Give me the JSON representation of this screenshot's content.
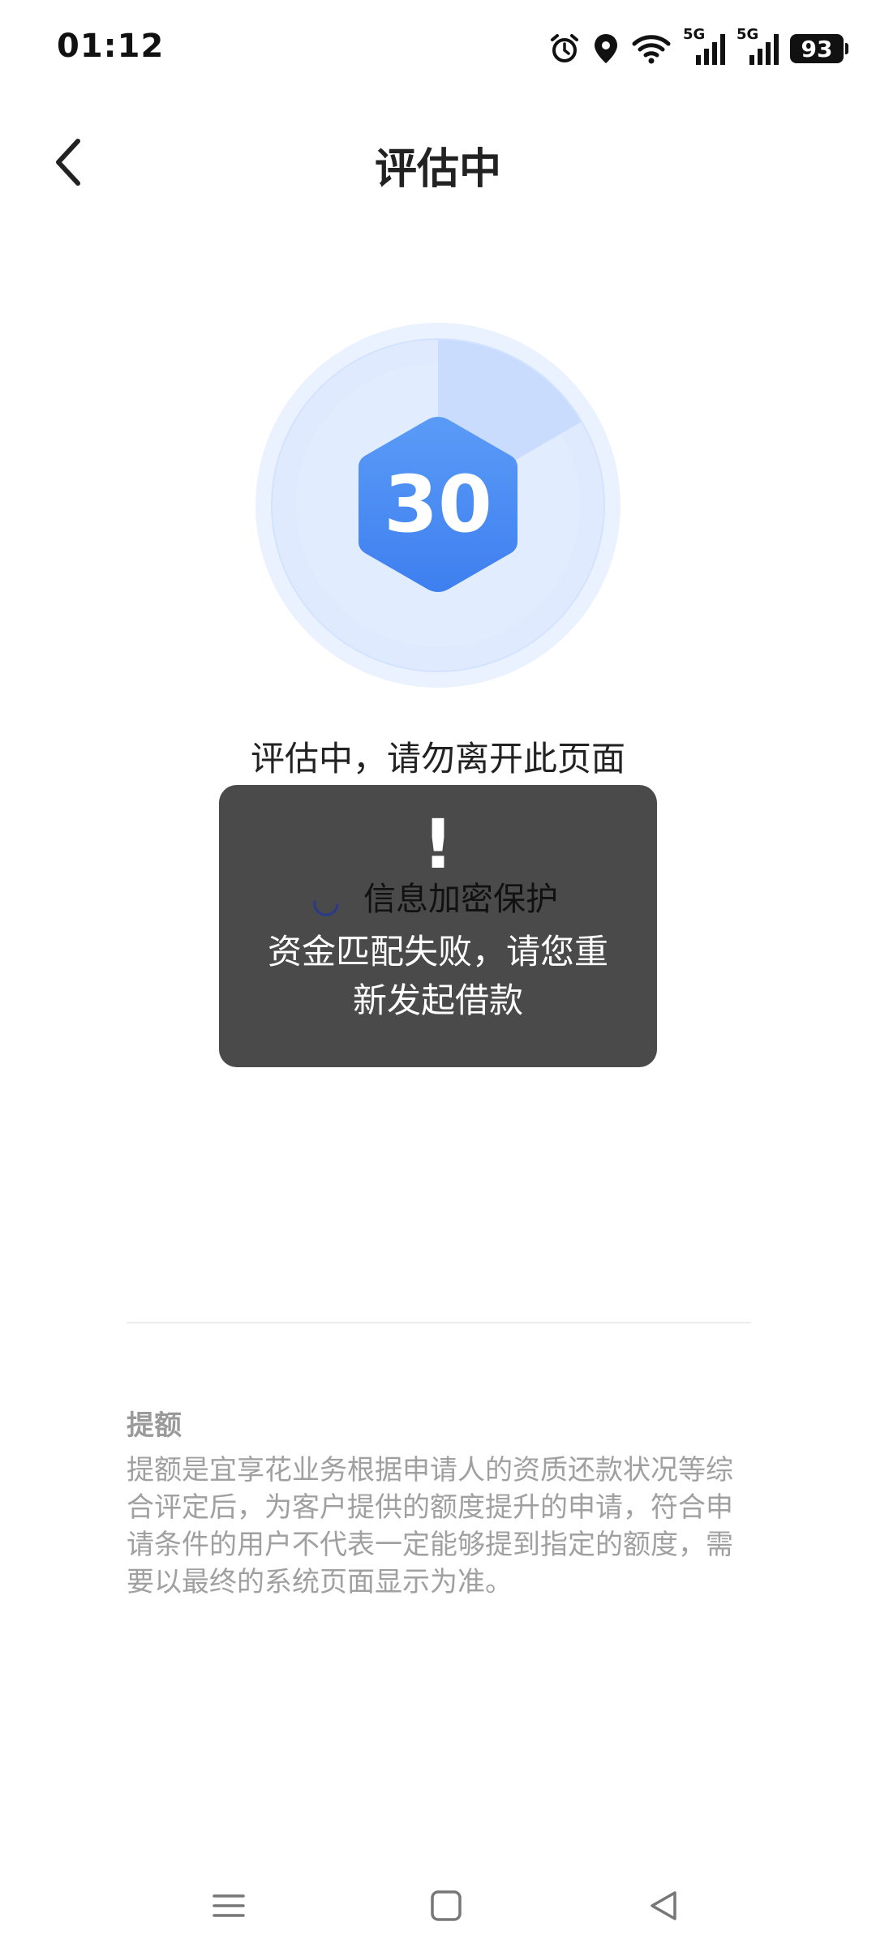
{
  "status_bar": {
    "time": "01:12",
    "battery": "93",
    "network_labels": [
      "5G",
      "5G"
    ]
  },
  "header": {
    "title": "评估中"
  },
  "progress": {
    "countdown": "30",
    "status_text": "评估中，请勿离开此页面",
    "sub_text": "信息加密保护"
  },
  "toast": {
    "icon": "!",
    "message": "资金匹配失败，请您重新发起借款"
  },
  "note": {
    "title": "提额",
    "body": "提额是宜享花业务根据申请人的资质还款状况等综合评定后，为客户提供的额度提升的申请，符合申请条件的用户不代表一定能够提到指定的额度，需要以最终的系统页面显示为准。"
  },
  "colors": {
    "accent_blue": "#3d86f5",
    "hex_top": "#5a9bf7",
    "hex_bottom": "#3e7ff0",
    "toast_bg": "#4a4a4a",
    "note_text": "#a0a0a0"
  },
  "icons": {
    "back": "chevron-left-icon",
    "alarm": "alarm-icon",
    "location": "location-icon",
    "wifi": "wifi-icon",
    "signal": "signal-icon",
    "nav_menu": "menu-icon",
    "nav_home": "home-square-icon",
    "nav_back": "triangle-back-icon"
  }
}
